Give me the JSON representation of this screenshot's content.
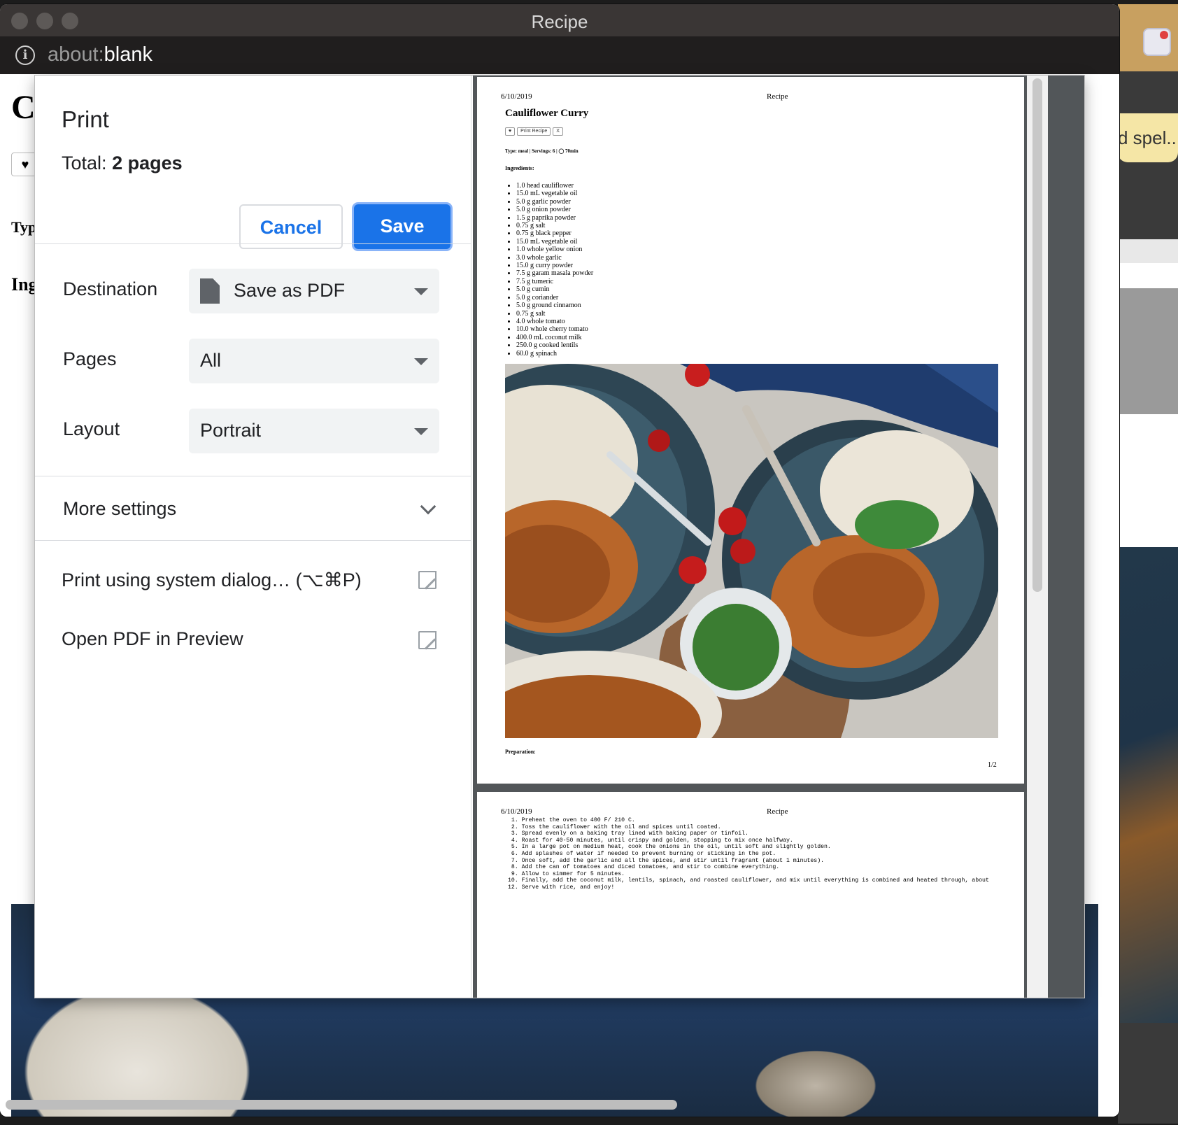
{
  "window": {
    "title": "Recipe",
    "url_prefix": "about:",
    "url_strong": "blank"
  },
  "side_window": {
    "toast": "d spel..."
  },
  "underlying_page": {
    "heading": "C",
    "heart": "♥",
    "type_label": "Typ",
    "ingredients_label": "Ing"
  },
  "print": {
    "title": "Print",
    "total_label": "Total:",
    "total_value": "2 pages",
    "cancel": "Cancel",
    "save": "Save",
    "destination": {
      "label": "Destination",
      "value": "Save as PDF",
      "icon": "file-icon"
    },
    "pages": {
      "label": "Pages",
      "value": "All"
    },
    "layout": {
      "label": "Layout",
      "value": "Portrait"
    },
    "more_settings": "More settings",
    "system_dialog": "Print using system dialog… (⌥⌘P)",
    "open_preview": "Open PDF in Preview"
  },
  "preview": {
    "page1": {
      "date": "6/10/2019",
      "header": "Recipe",
      "title": "Cauliflower Curry",
      "buttons": [
        "♥",
        "Print Recipe",
        "X"
      ],
      "type_line": "Type: meal | Servings: 6 | ◯ 70min",
      "ingredients_label": "Ingredients:",
      "ingredients": [
        "1.0 head cauliflower",
        "15.0 mL vegetable oil",
        "5.0 g garlic powder",
        "5.0 g onion powder",
        "1.5 g paprika powder",
        "0.75 g salt",
        "0.75 g black pepper",
        "15.0 mL vegetable oil",
        "1.0 whole yellow onion",
        "3.0 whole garlic",
        "15.0 g curry powder",
        "7.5 g garam masala powder",
        "7.5 g tumeric",
        "5.0 g cumin",
        "5.0 g coriander",
        "5.0 g ground cinnamon",
        "0.75 g salt",
        "4.0 whole tomato",
        "10.0 whole cherry tomato",
        "400.0 mL coconut milk",
        "250.0 g cooked lentils",
        "60.0 g spinach"
      ],
      "preparation_label": "Preparation:",
      "page_number": "1/2"
    },
    "page2": {
      "date": "6/10/2019",
      "header": "Recipe",
      "steps": [
        " 1. Preheat the oven to 400 F/ 210 C.",
        " 2. Toss the cauliflower with the oil and spices until coated.",
        " 3. Spread evenly on a baking tray lined with baking paper or tinfoil.",
        " 4. Roast for 40-50 minutes, until crispy and golden, stopping to mix once halfway.",
        " 5. In a large pot on medium heat, cook the onions in the oil, until soft and slightly golden.",
        " 6. Add splashes of water if needed to prevent burning or sticking in the pot.",
        " 7. Once soft, add the garlic and all the spices, and stir until fragrant (about 1 minutes).",
        " 8. Add the can of tomatoes and diced tomatoes, and stir to combine everything.",
        " 9. Allow to simmer for 5 minutes.",
        "10. Finally, add the coconut milk, lentils, spinach, and roasted cauliflower, and mix until everything is combined and heated through, about",
        "12. Serve with rice, and enjoy!"
      ]
    }
  }
}
